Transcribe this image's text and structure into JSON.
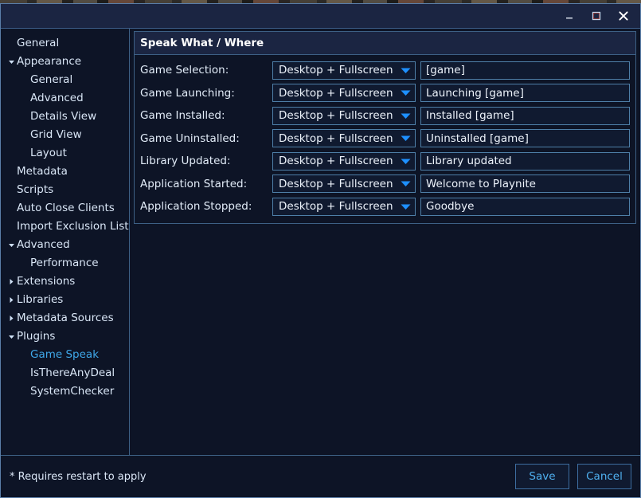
{
  "window": {
    "title": "",
    "controls": [
      {
        "name": "minimize-button",
        "glyph": "minimize"
      },
      {
        "name": "maximize-button",
        "glyph": "maximize"
      },
      {
        "name": "close-button",
        "glyph": "close"
      }
    ]
  },
  "sidebar": {
    "items": [
      {
        "label": "General",
        "level": 0,
        "expander": "none",
        "selected": false
      },
      {
        "label": "Appearance",
        "level": 0,
        "expander": "expanded",
        "selected": false
      },
      {
        "label": "General",
        "level": 1,
        "expander": "none",
        "selected": false
      },
      {
        "label": "Advanced",
        "level": 1,
        "expander": "none",
        "selected": false
      },
      {
        "label": "Details View",
        "level": 1,
        "expander": "none",
        "selected": false
      },
      {
        "label": "Grid View",
        "level": 1,
        "expander": "none",
        "selected": false
      },
      {
        "label": "Layout",
        "level": 1,
        "expander": "none",
        "selected": false
      },
      {
        "label": "Metadata",
        "level": 0,
        "expander": "none",
        "selected": false
      },
      {
        "label": "Scripts",
        "level": 0,
        "expander": "none",
        "selected": false
      },
      {
        "label": "Auto Close Clients",
        "level": 0,
        "expander": "none",
        "selected": false
      },
      {
        "label": "Import Exclusion List",
        "level": 0,
        "expander": "none",
        "selected": false
      },
      {
        "label": "Advanced",
        "level": 0,
        "expander": "expanded",
        "selected": false
      },
      {
        "label": "Performance",
        "level": 1,
        "expander": "none",
        "selected": false
      },
      {
        "label": "Extensions",
        "level": 0,
        "expander": "collapsed",
        "selected": false
      },
      {
        "label": "Libraries",
        "level": 0,
        "expander": "collapsed",
        "selected": false
      },
      {
        "label": "Metadata Sources",
        "level": 0,
        "expander": "collapsed",
        "selected": false
      },
      {
        "label": "Plugins",
        "level": 0,
        "expander": "expanded",
        "selected": false
      },
      {
        "label": "Game Speak",
        "level": 1,
        "expander": "none",
        "selected": true
      },
      {
        "label": "IsThereAnyDeal",
        "level": 1,
        "expander": "none",
        "selected": false
      },
      {
        "label": "SystemChecker",
        "level": 1,
        "expander": "none",
        "selected": false
      }
    ]
  },
  "content": {
    "section_title": "Speak What / Where",
    "rows": [
      {
        "label": "Game Selection:",
        "where": "Desktop + Fullscreen",
        "text": "[game]"
      },
      {
        "label": "Game Launching:",
        "where": "Desktop + Fullscreen",
        "text": "Launching [game]"
      },
      {
        "label": "Game Installed:",
        "where": "Desktop + Fullscreen",
        "text": "Installed [game]"
      },
      {
        "label": "Game Uninstalled:",
        "where": "Desktop + Fullscreen",
        "text": "Uninstalled [game]"
      },
      {
        "label": "Library Updated:",
        "where": "Desktop + Fullscreen",
        "text": "Library updated"
      },
      {
        "label": "Application Started:",
        "where": "Desktop + Fullscreen",
        "text": "Welcome to Playnite"
      },
      {
        "label": "Application Stopped:",
        "where": "Desktop + Fullscreen",
        "text": "Goodbye"
      }
    ]
  },
  "footer": {
    "restart_note": "* Requires restart to apply",
    "save_label": "Save",
    "cancel_label": "Cancel"
  },
  "colors": {
    "window_bg": "#0d1426",
    "titlebar_bg": "#1b2542",
    "border": "#3d6085",
    "accent": "#3fa7e8",
    "text": "#e2ecf8",
    "chevron": "#1e90ff",
    "maximize_outline": "#b03030"
  }
}
